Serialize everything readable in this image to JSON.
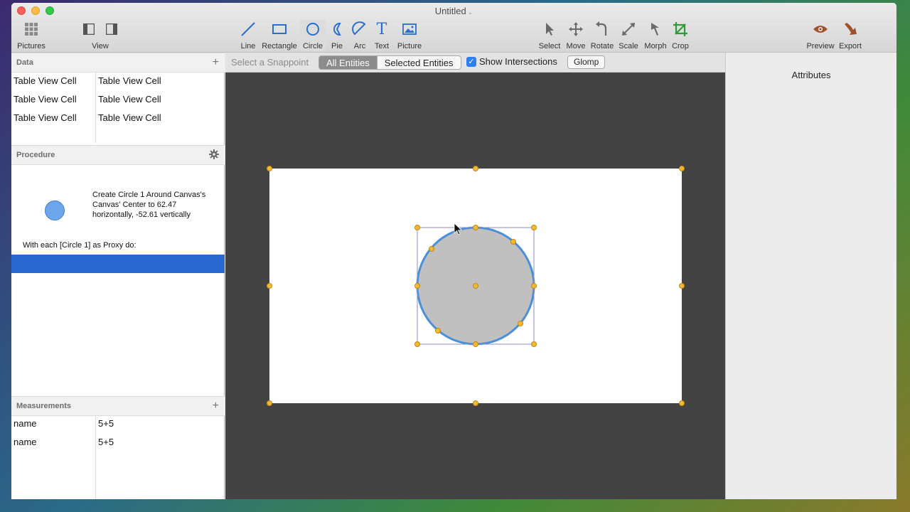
{
  "window": {
    "title": "Untitled"
  },
  "toolbar": {
    "left": [
      {
        "label": "Pictures",
        "icon": "grid-icon"
      },
      {
        "label": "View",
        "icon": "sidebar-toggle-icon"
      }
    ],
    "tools": [
      {
        "label": "Line",
        "icon": "line-icon"
      },
      {
        "label": "Rectangle",
        "icon": "rectangle-icon"
      },
      {
        "label": "Circle",
        "icon": "circle-icon",
        "active": true
      },
      {
        "label": "Pie",
        "icon": "pie-icon"
      },
      {
        "label": "Arc",
        "icon": "arc-icon"
      },
      {
        "label": "Text",
        "icon": "text-icon"
      },
      {
        "label": "Picture",
        "icon": "picture-icon"
      }
    ],
    "transforms": [
      {
        "label": "Select",
        "icon": "cursor-icon"
      },
      {
        "label": "Move",
        "icon": "move-icon"
      },
      {
        "label": "Rotate",
        "icon": "rotate-icon"
      },
      {
        "label": "Scale",
        "icon": "scale-icon"
      },
      {
        "label": "Morph",
        "icon": "morph-icon"
      },
      {
        "label": "Crop",
        "icon": "crop-icon"
      }
    ],
    "right": [
      {
        "label": "Preview",
        "icon": "eye-icon"
      },
      {
        "label": "Export",
        "icon": "export-icon"
      }
    ]
  },
  "data_section": {
    "title": "Data",
    "rows": [
      [
        "Table View Cell",
        "Table View Cell"
      ],
      [
        "Table View Cell",
        "Table View Cell"
      ],
      [
        "Table View Cell",
        "Table View Cell"
      ]
    ]
  },
  "procedure": {
    "title": "Procedure",
    "step_text": "Create Circle 1 Around Canvas's Canvas' Center to 62.47 horizontally, -52.61 vertically",
    "with_text": "With each  [Circle 1] as Proxy do:"
  },
  "measurements": {
    "title": "Measurements",
    "rows": [
      [
        "name",
        "5+5"
      ],
      [
        "name",
        "5+5"
      ]
    ]
  },
  "snapbar": {
    "label": "Select a Snappoint",
    "segments": [
      "All Entities",
      "Selected Entities"
    ],
    "selected_segment": "All Entities",
    "show_intersections_label": "Show Intersections",
    "show_intersections_checked": true,
    "glomp_label": "Glomp"
  },
  "attributes": {
    "title": "Attributes"
  },
  "colors": {
    "accent": "#2a68d1",
    "canvas_bg": "#434343",
    "circle_fill": "#c0c0c0",
    "circle_stroke": "#4a90d9",
    "handle": "#f5b830"
  }
}
